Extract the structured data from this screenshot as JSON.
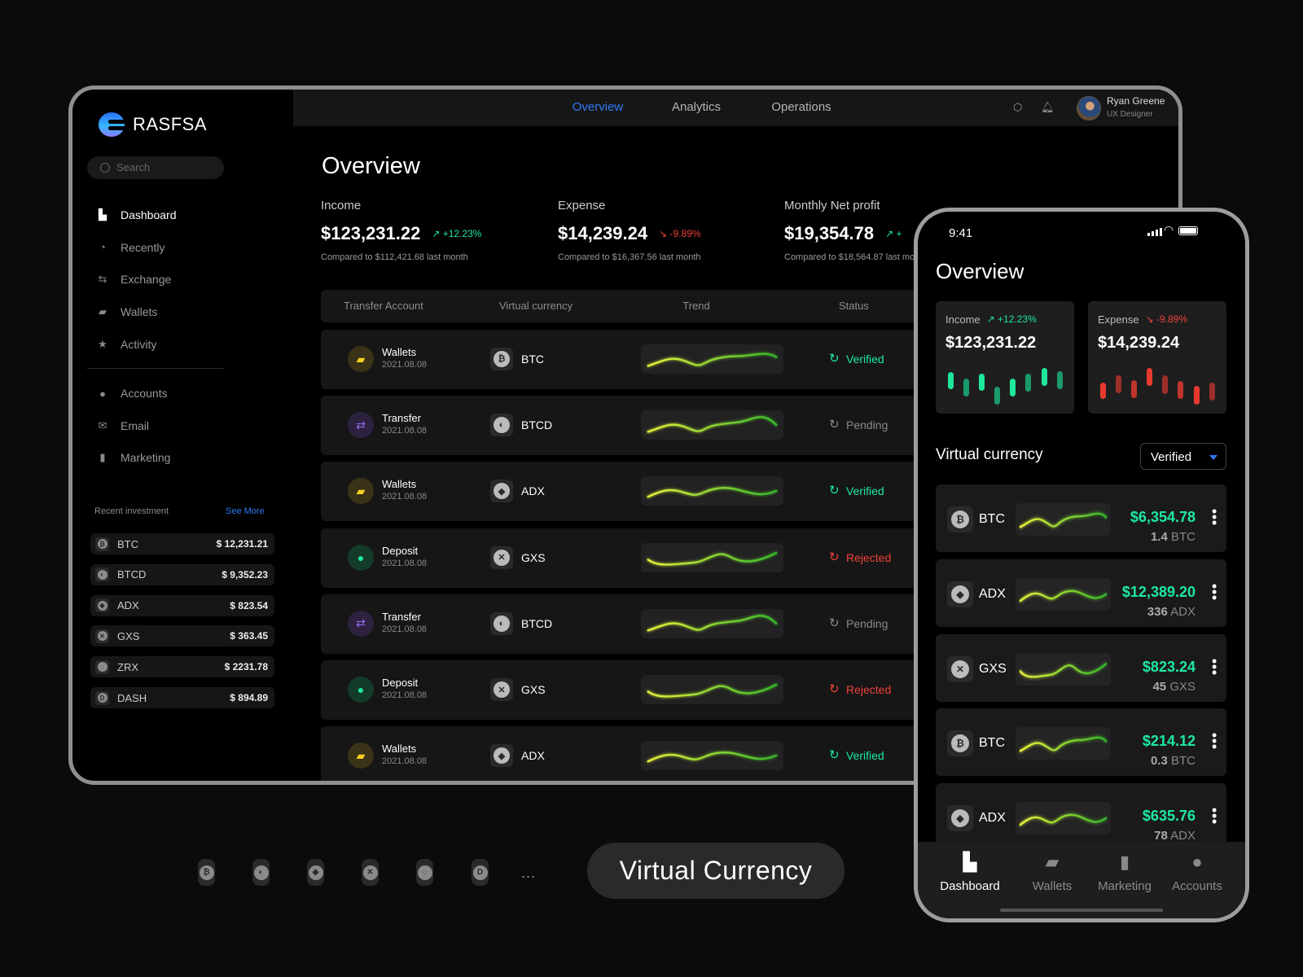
{
  "app": {
    "brand": "RASFSA",
    "search_placeholder": "Search"
  },
  "sidebar": {
    "items": [
      {
        "label": "Dashboard",
        "icon": "dashboard-icon",
        "glyph": "▙",
        "active": true
      },
      {
        "label": "Recently",
        "icon": "clock-icon",
        "glyph": "◔"
      },
      {
        "label": "Exchange",
        "icon": "exchange-icon",
        "glyph": "⇆"
      },
      {
        "label": "Wallets",
        "icon": "wallet-icon",
        "glyph": "▰"
      },
      {
        "label": "Activity",
        "icon": "bookmark-star-icon",
        "glyph": "★"
      }
    ],
    "items2": [
      {
        "label": "Accounts",
        "icon": "user-icon",
        "glyph": "●"
      },
      {
        "label": "Email",
        "icon": "mail-icon",
        "glyph": "✉"
      },
      {
        "label": "Marketing",
        "icon": "bar-chart-icon",
        "glyph": "▮"
      }
    ],
    "recent_label": "Recent investment",
    "see_more": "See More",
    "recent": [
      {
        "symbol": "BTC",
        "glyph": "₿",
        "amount": "$ 12,231.21"
      },
      {
        "symbol": "BTCD",
        "glyph": "◐",
        "amount": "$ 9,352.23"
      },
      {
        "symbol": "ADX",
        "glyph": "◆",
        "amount": "$ 823.54"
      },
      {
        "symbol": "GXS",
        "glyph": "✕",
        "amount": "$ 363.45"
      },
      {
        "symbol": "ZRX",
        "glyph": "◌",
        "amount": "$ 2231.78"
      },
      {
        "symbol": "DASH",
        "glyph": "D",
        "amount": "$ 894.89"
      }
    ]
  },
  "topnav": {
    "tabs": [
      "Overview",
      "Analytics",
      "Operations"
    ],
    "active": 0,
    "user": {
      "name": "Ryan Greene",
      "role": "UX Designer"
    }
  },
  "main": {
    "title": "Overview",
    "stats": [
      {
        "label": "Income",
        "value": "$123,231.22",
        "change": "+12.23%",
        "dir": "up",
        "compare": "Compared to $112,421.68 last month"
      },
      {
        "label": "Expense",
        "value": "$14,239.24",
        "change": "-9.89%",
        "dir": "down",
        "compare": "Compared to $16,367.56 last month"
      },
      {
        "label": "Monthly Net profit",
        "value": "$19,354.78",
        "change": "+",
        "dir": "up",
        "compare": "Compared to $18,564.87 last month"
      }
    ],
    "columns": [
      "Transfer Account",
      "Virtual currency",
      "Trend",
      "Status"
    ],
    "rows": [
      {
        "type": "Wallets",
        "date": "2021.08.08",
        "currency": "BTC",
        "status": "Verified"
      },
      {
        "type": "Transfer",
        "date": "2021.08.08",
        "currency": "BTCD",
        "status": "Pending"
      },
      {
        "type": "Wallets",
        "date": "2021.08.08",
        "currency": "ADX",
        "status": "Verified"
      },
      {
        "type": "Deposit",
        "date": "2021.08.08",
        "currency": "GXS",
        "status": "Rejected"
      },
      {
        "type": "Transfer",
        "date": "2021.08.08",
        "currency": "BTCD",
        "status": "Pending"
      },
      {
        "type": "Deposit",
        "date": "2021.08.08",
        "currency": "GXS",
        "status": "Rejected"
      },
      {
        "type": "Wallets",
        "date": "2021.08.08",
        "currency": "ADX",
        "status": "Verified"
      }
    ]
  },
  "colors": {
    "accent": "#2f7bf5",
    "up": "#1de9a0",
    "down": "#f0413a",
    "pending": "#8a8a8a"
  },
  "phone": {
    "time": "9:41",
    "title": "Overview",
    "cards": [
      {
        "label": "Income",
        "change": "+12.23%",
        "dir": "up",
        "value": "$123,231.22",
        "bars": [
          [
            22,
            43
          ],
          [
            13,
            35
          ],
          [
            20,
            41
          ],
          [
            3,
            25
          ],
          [
            13,
            35
          ],
          [
            19,
            41
          ],
          [
            26,
            48
          ],
          [
            22,
            44
          ]
        ]
      },
      {
        "label": "Expense",
        "change": "-9.89%",
        "dir": "down",
        "value": "$14,239.24",
        "bars": [
          [
            10,
            30
          ],
          [
            17,
            39
          ],
          [
            11,
            33
          ],
          [
            26,
            48
          ],
          [
            16,
            39
          ],
          [
            10,
            32
          ],
          [
            3,
            26
          ],
          [
            8,
            30
          ]
        ]
      }
    ],
    "section": "Virtual currency",
    "filter": "Verified",
    "list": [
      {
        "symbol": "BTC",
        "price": "$6,354.78",
        "amount": "1.4",
        "unit": "BTC"
      },
      {
        "symbol": "ADX",
        "price": "$12,389.20",
        "amount": "336",
        "unit": "ADX"
      },
      {
        "symbol": "GXS",
        "price": "$823.24",
        "amount": "45",
        "unit": "GXS"
      },
      {
        "symbol": "BTC",
        "price": "$214.12",
        "amount": "0.3",
        "unit": "BTC"
      },
      {
        "symbol": "ADX",
        "price": "$635.76",
        "amount": "78",
        "unit": "ADX"
      }
    ],
    "tabs": [
      {
        "label": "Dashboard",
        "glyph": "▙",
        "active": true
      },
      {
        "label": "Wallets",
        "glyph": "▰"
      },
      {
        "label": "Marketing",
        "glyph": "▮"
      },
      {
        "label": "Accounts",
        "glyph": "●"
      }
    ]
  },
  "footer": {
    "coins": [
      "BTC",
      "BTCD",
      "ADX",
      "GXS",
      "ZRX",
      "DASH"
    ],
    "more": "...",
    "label": "Virtual Currency"
  }
}
